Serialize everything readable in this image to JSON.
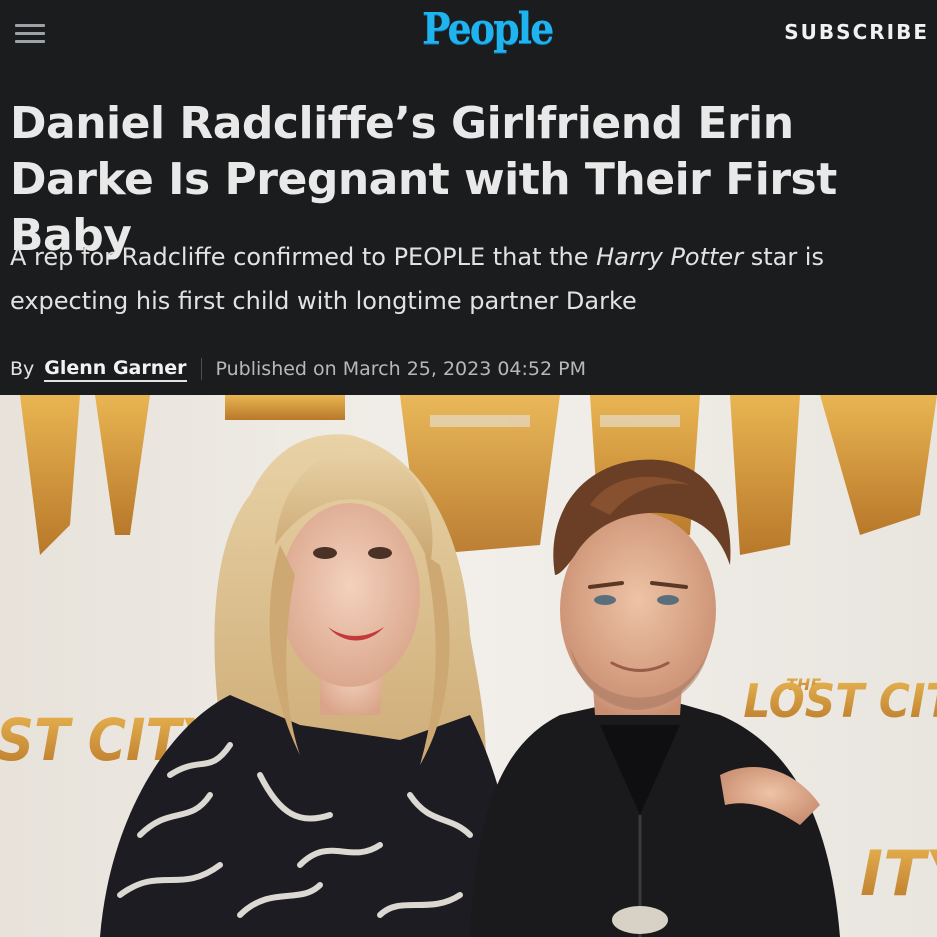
{
  "header": {
    "menu_icon": "hamburger-menu-icon",
    "logo": "People",
    "subscribe_label": "SUBSCRIBE"
  },
  "article": {
    "headline": "Daniel Radcliffe’s Girlfriend Erin Darke Is Pregnant with Their First Baby",
    "dek_before": "A rep for Radcliffe confirmed to PEOPLE that the ",
    "dek_italic": "Harry Potter",
    "dek_after": " star is expecting his first child with longtime partner Darke",
    "byline_prefix": "By",
    "author": "Glenn Garner",
    "published": "Published on March 25, 2023 04:52 PM"
  },
  "photo": {
    "backdrop_text_top": "THE LOST CITY",
    "backdrop_text_left": "ST CITY",
    "backdrop_text_right": "LOST CIT",
    "backdrop_text_right_small": "THE",
    "backdrop_text_bottom_right": "ITY"
  },
  "colors": {
    "background": "#1a1c1e",
    "logo": "#1fb4ef",
    "text": "#e9e9e9",
    "backdrop_gold": "#d9a23a"
  }
}
